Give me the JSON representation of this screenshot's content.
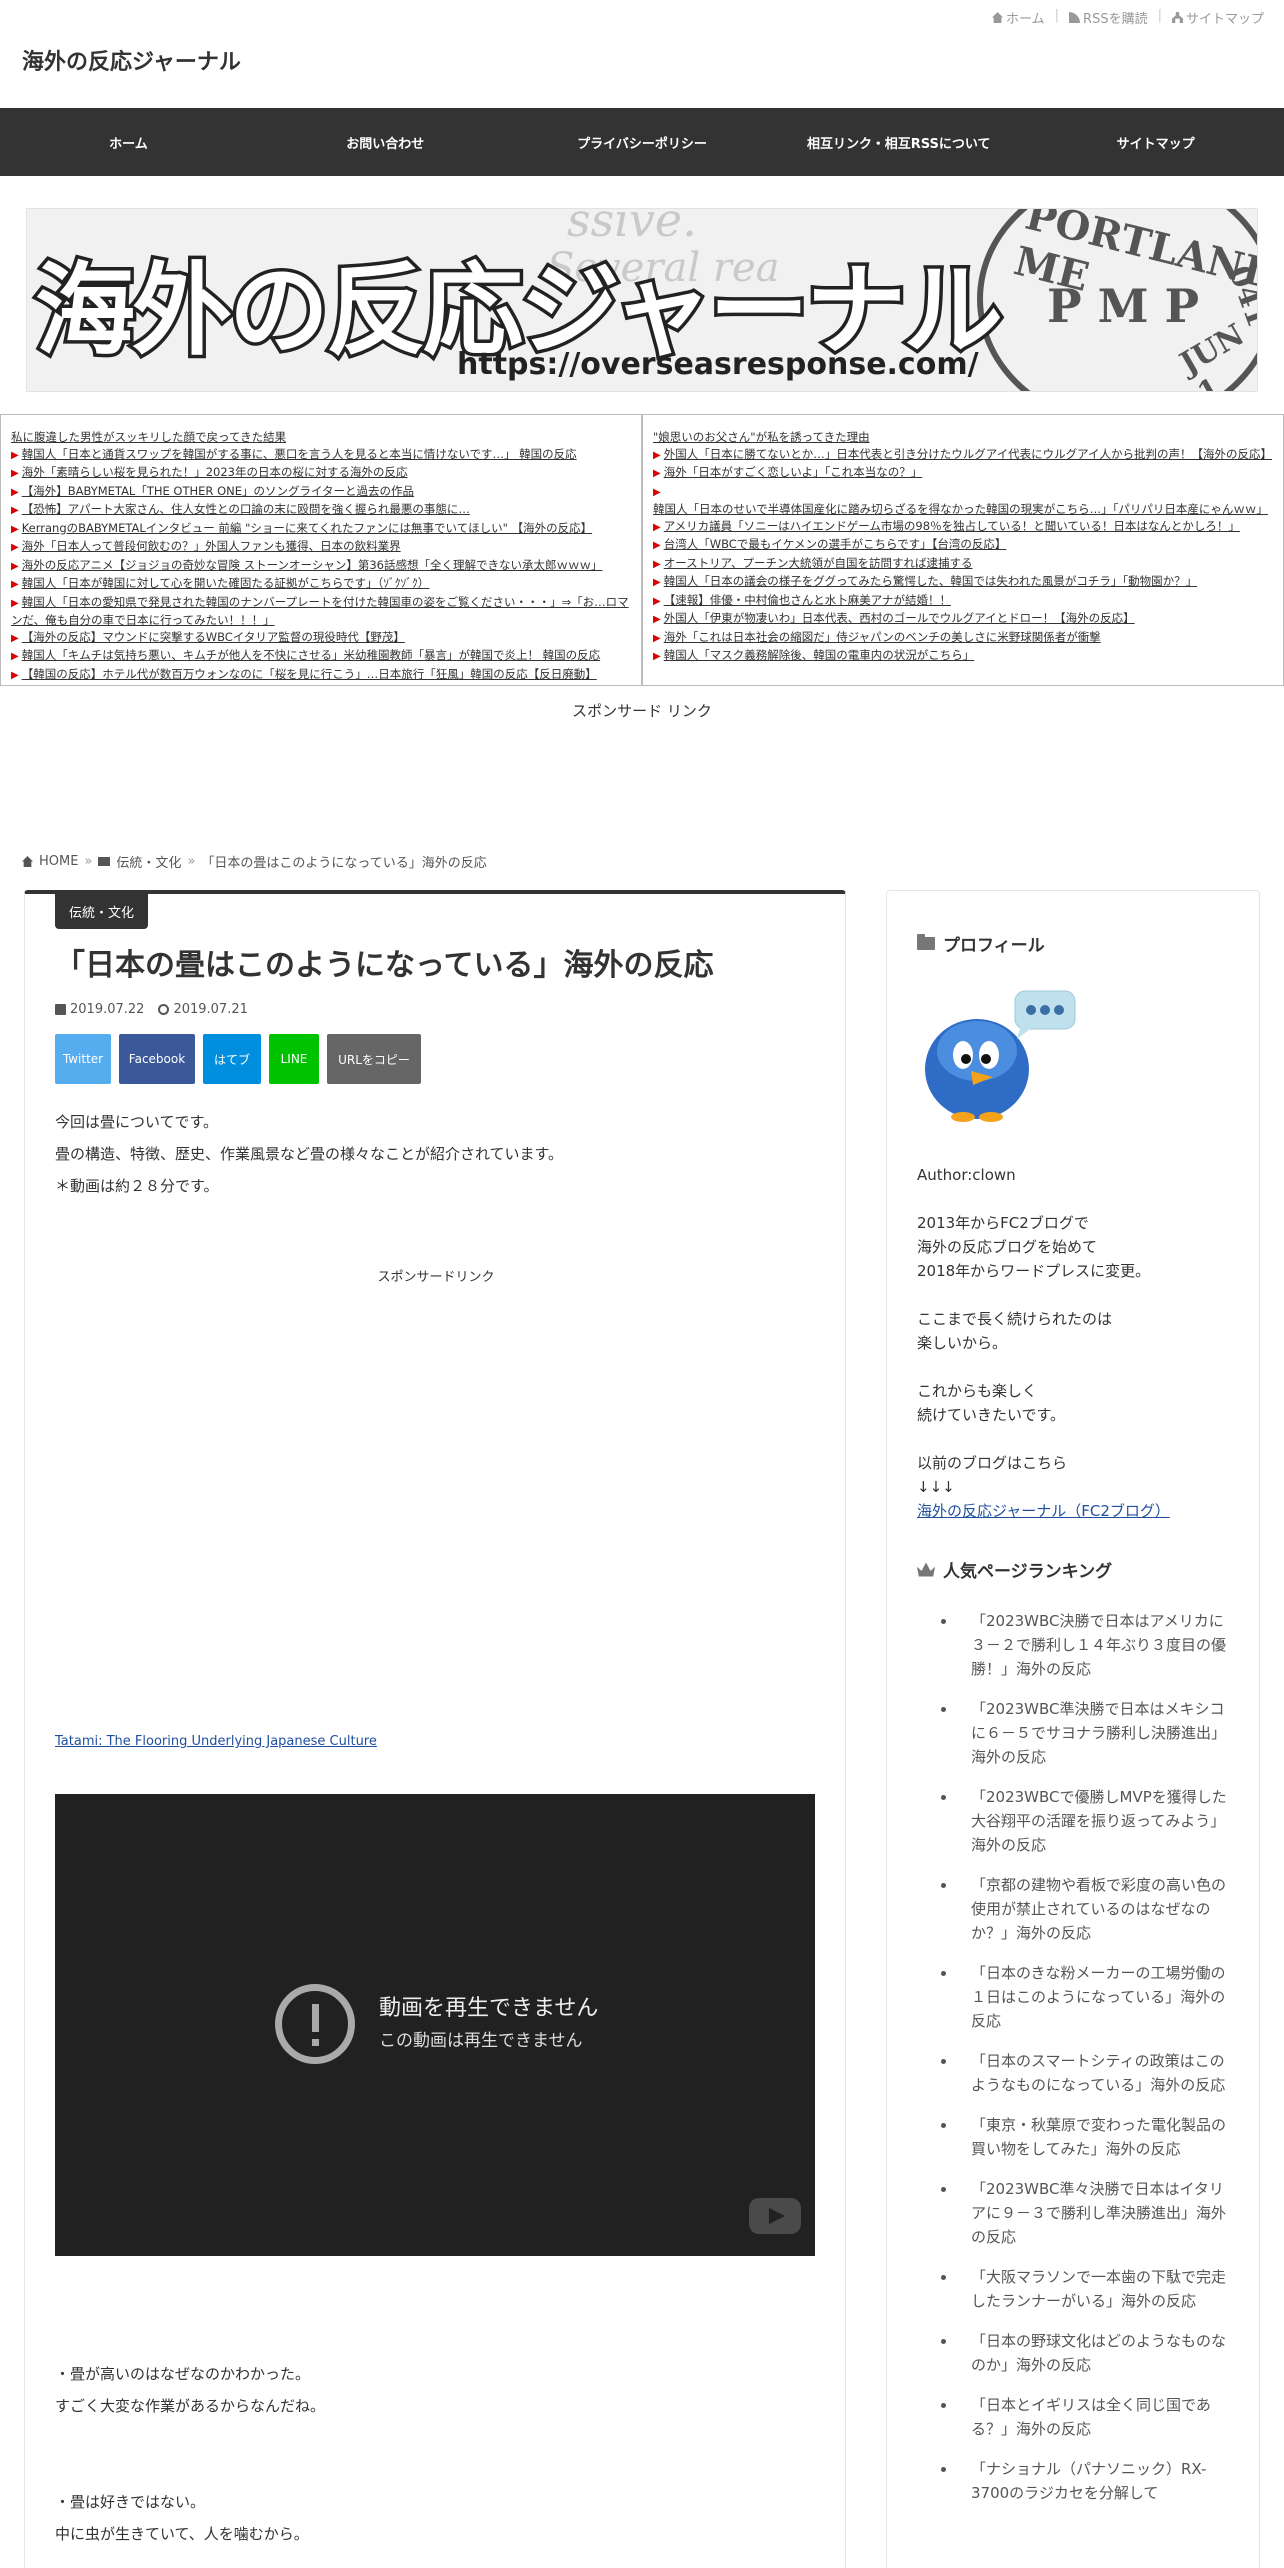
{
  "topbar": {
    "home": "ホーム",
    "rss": "RSSを購読",
    "sitemap": "サイトマップ"
  },
  "site": {
    "title": "海外の反応ジャーナル"
  },
  "nav": [
    "ホーム",
    "お問い合わせ",
    "プライバシーポリシー",
    "相互リンク・相互RSSについて",
    "サイトマップ"
  ],
  "banner": {
    "title": "海外の反応ジャーナル",
    "url": "https://overseasresponse.com/",
    "bg_text_1": "ssive.",
    "bg_text_2": "Several rea",
    "stamp_text": "PORTLAND, ME",
    "stamp_mid": "P M P",
    "stamp_date": "JUN 1",
    "stamp_num": "041"
  },
  "rss_left": [
    "私に腹違した男性がスッキリした顔で戻ってきた結果",
    "韓国人「日本と通貨スワップを韓国がする事に、悪口を言う人を見ると本当に情けないです…」 韓国の反応",
    "海外「素晴らしい桜を見られた！」2023年の日本の桜に対する海外の反応",
    "【海外】BABYMETAL「THE OTHER ONE」のソングライターと過去の作品",
    "【恐怖】アパート大家さん、住人女性との口論の末に殴問を強く握られ最悪の事態に…",
    "KerrangのBABYMETALインタビュー 前編 \"ショーに来てくれたファンには無事でいてほしい\" 【海外の反応】",
    "海外「日本人って普段何飲むの？」外国人ファンも獲得、日本の飲料業界",
    "海外の反応アニメ【ジョジョの奇妙な冒険 ストーンオーシャン】第36話感想「全く理解できない承太郎ｗｗｗ」",
    "韓国人「日本が韓国に対して心を開いた確固たる証拠がこちらです」（ｿﾞｸｿﾞｸ）",
    "韓国人「日本の愛知県で発見された韓国のナンバープレートを付けた韓国車の姿をご覧ください・・・」⇒「お…ロマンだ、俺も自分の車で日本に行ってみたい！！！」",
    "【海外の反応】マウンドに突撃するWBCイタリア監督の現役時代【野茂】",
    "韓国人「キムチは気持ち悪い、キムチが他人を不快にさせる」米幼稚園教師「暴言」が韓国で炎上！ 韓国の反応",
    "【韓国の反応】ホテル代が数百万ウォンなのに「桜を見に行こう」…日本旅行「狂風」韓国の反応【反日廃動】"
  ],
  "rss_right": [
    "\"娘思いのお父さん\"が私を誘ってきた理由",
    "外国人「日本に勝てないとか…」日本代表と引き分けたウルグアイ代表にウルグアイ人から批判の声！【海外の反応】",
    "海外「日本がすごく恋しいよ」「これ本当なの？」",
    "韓国人「日本のせいで半導体国産化に踏み切らざるを得なかった韓国の現実がこちら…」「パリパリ日本産にゃんｗｗ」",
    "アメリカ議員「ソニーはハイエンドゲーム市場の98％を独占している！と聞いている！日本はなんとかしろ！」",
    "台湾人「WBCで最もイケメンの選手がこちらです」【台湾の反応】",
    "オーストリア、プーチン大統領が自国を訪問すれば逮捕する",
    "韓国人「日本の議会の様子をググってみたら驚愕した、韓国では失われた風景がコチラ」「動物園か？」",
    "【速報】俳優・中村倫也さんと水卜麻美アナが結婚！！",
    "外国人「伊東が物凄いわ」日本代表、西村のゴールでウルグアイとドロー！【海外の反応】",
    "海外「これは日本社会の縮図だ」侍ジャパンのベンチの美しさに米野球関係者が衝撃",
    "韓国人「マスク義務解除後、韓国の電車内の状況がこちら」"
  ],
  "sponsor_top": "スポンサード リンク",
  "breadcrumb": {
    "home": "HOME",
    "category": "伝統・文化",
    "current": "「日本の畳はこのようになっている」海外の反応"
  },
  "post": {
    "category": "伝統・文化",
    "title": "「日本の畳はこのようになっている」海外の反応",
    "published": "2019.07.22",
    "updated": "2019.07.21",
    "share": {
      "twitter": "Twitter",
      "facebook": "Facebook",
      "hatena": "はてブ",
      "line": "LINE",
      "copy": "URLをコピー"
    },
    "intro_1": "今回は畳についてです。",
    "intro_2": "畳の構造、特徴、歴史、作業風景など畳の様々なことが紹介されています。",
    "intro_3": "＊動画は約２８分です。",
    "sponsor_mid": "スポンサードリンク",
    "video_link": "Tatami: The Flooring Underlying Japanese Culture",
    "video_error_title": "動画を再生できません",
    "video_error_sub": "この動画は再生できません",
    "comment_1a": "・畳が高いのはなぜなのかわかった。",
    "comment_1b": "すごく大変な作業があるからなんだね。",
    "comment_2a": "・畳は好きではない。",
    "comment_2b": "中に虫が生きていて、人を噛むから。"
  },
  "sidebar": {
    "profile_title": "プロフィール",
    "author": "Author:clown",
    "p1": [
      "2013年からFC2ブログで",
      "海外の反応ブログを始めて",
      "2018年からワードプレスに変更。"
    ],
    "p2": [
      "ここまで長く続けられたのは",
      "楽しいから。"
    ],
    "p3": [
      "これからも楽しく",
      "続けていきたいです。"
    ],
    "p4": [
      "以前のブログはこちら",
      "↓↓↓"
    ],
    "fc2_link": "海外の反応ジャーナル（FC2ブログ）",
    "ranking_title": "人気ページランキング",
    "ranking": [
      "「2023WBC決勝で日本はアメリカに３－２で勝利し１４年ぶり３度目の優勝！」海外の反応",
      "「2023WBC準決勝で日本はメキシコに６－５でサヨナラ勝利し決勝進出」海外の反応",
      "「2023WBCで優勝しMVPを獲得した大谷翔平の活躍を振り返ってみよう」海外の反応",
      "「京都の建物や看板で彩度の高い色の使用が禁止されているのはなぜなのか？」海外の反応",
      "「日本のきな粉メーカーの工場労働の１日はこのようになっている」海外の反応",
      "「日本のスマートシティの政策はこのようなものになっている」海外の反応",
      "「東京・秋葉原で変わった電化製品の買い物をしてみた」海外の反応",
      "「2023WBC準々決勝で日本はイタリアに９－３で勝利し準決勝進出」海外の反応",
      "「大阪マラソンで一本歯の下駄で完走したランナーがいる」海外の反応",
      "「日本の野球文化はどのようなものなのか」海外の反応",
      "「日本とイギリスは全く同じ国である？」海外の反応",
      "「ナショナル（パナソニック）RX-3700のラジカセを分解して"
    ]
  }
}
